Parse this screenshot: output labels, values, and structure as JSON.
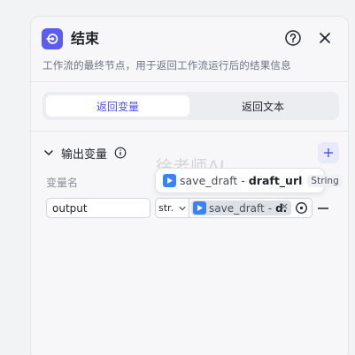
{
  "panel": {
    "title": "结束",
    "description": "工作流的最终节点，用于返回工作流运行后的结果信息",
    "icons": {
      "node": "end-node-icon",
      "help": "help-circle-icon",
      "close": "close-icon"
    }
  },
  "tabs": [
    {
      "label": "返回变量",
      "active": true
    },
    {
      "label": "返回文本",
      "active": false
    }
  ],
  "section": {
    "title": "输出变量",
    "column_label": "变量名",
    "rows": [
      {
        "name": "output",
        "type": "str.",
        "ref_source": "save_draft",
        "ref_sep": "-",
        "ref_short": "d.",
        "ref_remove": "×"
      }
    ]
  },
  "tooltip": {
    "source": "save_draft",
    "sep": "-",
    "variable": "draft_url",
    "type": "String"
  },
  "watermark": "徐老师AI",
  "colors": {
    "accent": "#5b5cf0",
    "active_tab_text": "#4c4ef2",
    "node_blue": "#3b82f6"
  }
}
